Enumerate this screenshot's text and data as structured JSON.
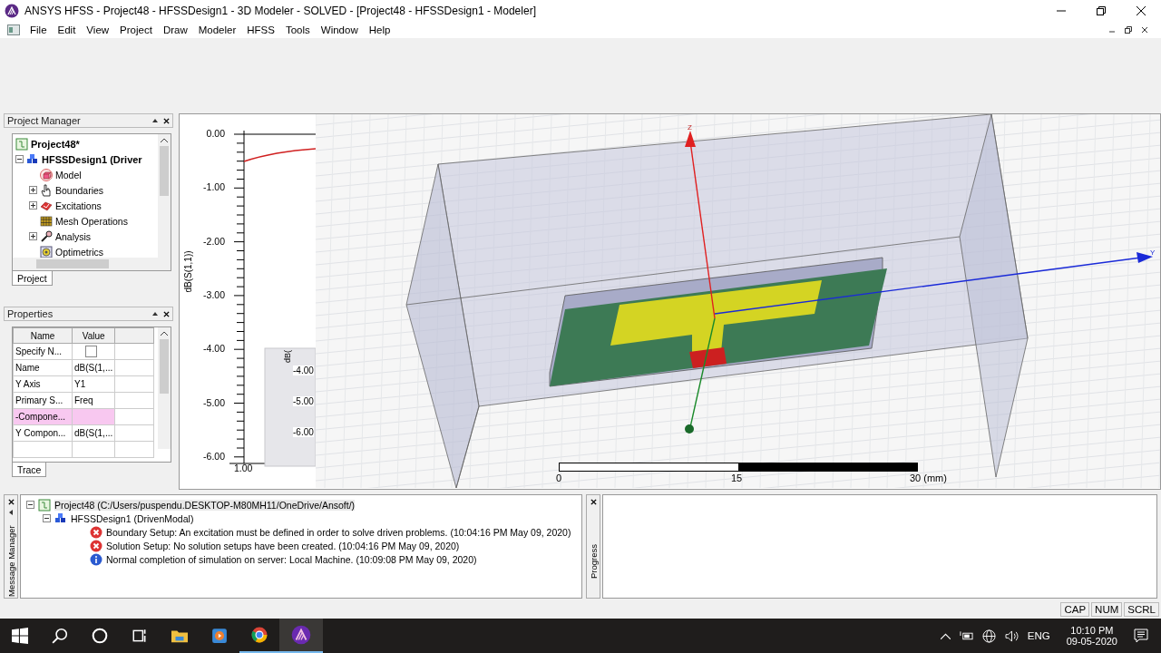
{
  "window": {
    "title": "ANSYS HFSS - Project48 - HFSSDesign1 - 3D Modeler - SOLVED - [Project48 - HFSSDesign1 - Modeler]"
  },
  "menu": [
    "File",
    "Edit",
    "View",
    "Project",
    "Draw",
    "Modeler",
    "HFSS",
    "Tools",
    "Window",
    "Help"
  ],
  "project_manager": {
    "title": "Project Manager",
    "tab": "Project",
    "tree": [
      {
        "label": "Project48*",
        "children": [
          {
            "label": "HFSSDesign1 (Driver",
            "expanded": true,
            "children": [
              {
                "label": "Model",
                "kind": "model",
                "expandable": false
              },
              {
                "label": "Boundaries",
                "kind": "boundaries",
                "expandable": true
              },
              {
                "label": "Excitations",
                "kind": "excitations",
                "expandable": true
              },
              {
                "label": "Mesh Operations",
                "kind": "mesh",
                "expandable": false
              },
              {
                "label": "Analysis",
                "kind": "analysis",
                "expandable": true
              },
              {
                "label": "Optimetrics",
                "kind": "optimetrics",
                "expandable": false
              }
            ]
          }
        ]
      }
    ]
  },
  "properties": {
    "title": "Properties",
    "tab": "Trace",
    "columns": [
      "Name",
      "Value"
    ],
    "rows": [
      {
        "name": "Specify N...",
        "kind": "checkbox",
        "checked": false,
        "selected": false
      },
      {
        "name": "Name",
        "kind": "text",
        "value": "dB(S(1,...",
        "selected": false
      },
      {
        "name": "Y Axis",
        "kind": "text",
        "value": "Y1",
        "selected": false
      },
      {
        "name": "Primary S...",
        "kind": "text",
        "value": "Freq",
        "selected": false
      },
      {
        "name": "-Compone...",
        "kind": "text",
        "selected": true
      },
      {
        "name": "Y Compon...",
        "kind": "text",
        "value": "dB(S(1,...",
        "selected": false
      }
    ]
  },
  "plot": {
    "ylabel": "dB(S(1,1))",
    "yticks": [
      "0.00",
      "-1.00",
      "-2.00",
      "-3.00",
      "-4.00",
      "-5.00",
      "-6.00"
    ],
    "xtick": "1.00",
    "inset_ylabel": "dB(",
    "inset_ticks": [
      "-4.00",
      "-5.00",
      "-6.00"
    ]
  },
  "modeler": {
    "axes": [
      "Z",
      "Y"
    ],
    "scale": [
      "0",
      "15",
      "30 (mm)"
    ]
  },
  "messages": {
    "title": "Message Manager",
    "tree": [
      {
        "label": "Project48 (C:/Users/puspendu.DESKTOP-M80MH11/OneDrive/Ansoft/)",
        "children": [
          {
            "label": "HFSSDesign1 (DrivenModal)",
            "children": [
              {
                "label": "Boundary Setup: An excitation must be defined in order to solve driven problems. (10:04:16 PM  May 09, 2020)",
                "kind": "error"
              },
              {
                "label": "Solution Setup: No solution setups have been created. (10:04:16 PM  May 09, 2020)",
                "kind": "error"
              },
              {
                "label": "Normal completion of simulation on server: Local Machine. (10:09:08 PM  May 09, 2020)",
                "kind": "info"
              }
            ]
          }
        ]
      }
    ]
  },
  "progress": {
    "title": "Progress"
  },
  "status_bar": [
    "CAP",
    "NUM",
    "SCRL"
  ],
  "taskbar": {
    "language": "ENG",
    "time": "10:10 PM",
    "date": "09-05-2020"
  }
}
